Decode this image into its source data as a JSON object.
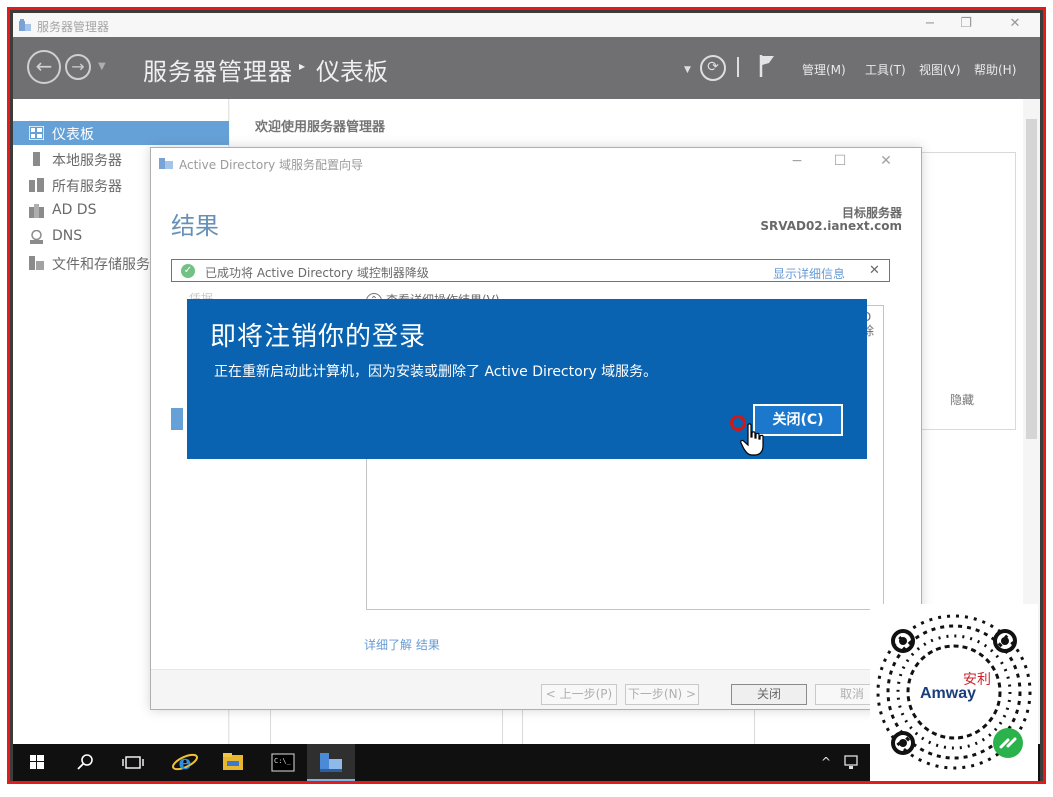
{
  "window": {
    "title": "服务器管理器"
  },
  "header": {
    "title": "服务器管理器",
    "separator": "▸",
    "subtitle": "仪表板",
    "menus": [
      "管理(M)",
      "工具(T)",
      "视图(V)",
      "帮助(H)"
    ]
  },
  "sidebar": {
    "items": [
      {
        "label": "仪表板",
        "icon": "dashboard-icon",
        "active": true
      },
      {
        "label": "本地服务器",
        "icon": "local-server-icon",
        "active": false
      },
      {
        "label": "所有服务器",
        "icon": "all-servers-icon",
        "active": false
      },
      {
        "label": "AD DS",
        "icon": "ad-ds-icon",
        "active": false
      },
      {
        "label": "DNS",
        "icon": "dns-icon",
        "active": false
      },
      {
        "label": "文件和存储服务",
        "icon": "file-storage-icon",
        "active": false
      }
    ]
  },
  "main": {
    "welcome": "欢迎使用服务器管理器",
    "hide_label": "隐藏"
  },
  "wizard": {
    "title": "Active Directory 域服务配置向导",
    "heading": "结果",
    "target_label": "目标服务器",
    "target_name": "SRVAD02.ianext.com",
    "banner_message": "已成功将 Active Directory 域控制器降级",
    "banner_details_link": "显示详细信息",
    "banner_close": "✕",
    "nav_item_faded": "凭据",
    "expander_label": "查看详细操作结果(V)",
    "results_fragment_line1": "D",
    "results_fragment_line2": "除",
    "learn_more": "详细了解 结果",
    "buttons": {
      "prev": "< 上一步(P)",
      "next": "下一步(N) >",
      "close": "关闭",
      "cancel": "取消"
    }
  },
  "logoff_dialog": {
    "heading": "即将注销你的登录",
    "message": "正在重新启动此计算机，因为安装或删除了 Active Directory 域服务。",
    "close_button": "关闭(C)"
  },
  "taskbar": {
    "items": [
      "start-icon",
      "search-icon",
      "task-view-icon",
      "internet-explorer-icon",
      "file-explorer-icon",
      "command-prompt-icon",
      "server-manager-icon"
    ],
    "tray_chevron": "^"
  },
  "colors": {
    "accent_blue": "#1c73c3",
    "dialog_blue": "#0a63b0",
    "header_dark": "#2d2d30",
    "frame_red": "#e31b1b",
    "success_green": "#2fa54b",
    "link_blue": "#1e6bbf"
  },
  "qr_code": {
    "logo_text": "Amway",
    "logo_chinese": "安利"
  }
}
